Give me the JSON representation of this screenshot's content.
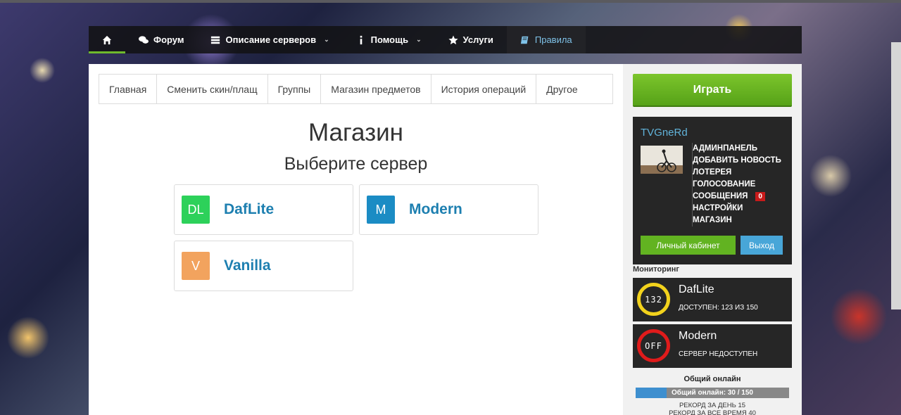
{
  "nav": {
    "home_icon": "home-icon",
    "items": [
      {
        "label": "Форум",
        "icon": "comments-icon"
      },
      {
        "label": "Описание серверов",
        "icon": "server-icon"
      },
      {
        "label": "Помощь",
        "icon": "info-icon"
      },
      {
        "label": "Услуги",
        "icon": "star-icon"
      },
      {
        "label": "Правила",
        "icon": "book-icon"
      }
    ]
  },
  "subnav": [
    "Главная",
    "Сменить скин/плащ",
    "Группы",
    "Магазин предметов",
    "История операций",
    "Другое"
  ],
  "main": {
    "title": "Магазин",
    "subtitle": "Выберите сервер",
    "servers": [
      {
        "badge": "DL",
        "name": "DafLite",
        "color": "#2dd15a"
      },
      {
        "badge": "M",
        "name": "Modern",
        "color": "#1b8cc4"
      },
      {
        "badge": "V",
        "name": "Vanilla",
        "color": "#f2a35e"
      }
    ]
  },
  "sidebar": {
    "play_label": "Играть",
    "username": "TVGneRd",
    "links": [
      "АДМИНПАНЕЛЬ",
      "ДОБАВИТЬ НОВОСТЬ",
      "ЛОТЕРЕЯ",
      "ГОЛОСОВАНИЕ",
      "СООБЩЕНИЯ",
      "НАСТРОЙКИ",
      "МАГАЗИН"
    ],
    "messages_count": "0",
    "cabinet_label": "Личный кабинет",
    "logout_label": "Выход",
    "monitoring_label": "Мониторинг",
    "monitor": [
      {
        "name": "DafLite",
        "gauge": "132",
        "status": "ДОСТУПЕН: 123 ИЗ 150",
        "color": "#f2d21c"
      },
      {
        "name": "Modern",
        "gauge": "OFF",
        "status": "СЕРВЕР НЕДОСТУПЕН",
        "color": "#e01b1b"
      }
    ],
    "online_title": "Общий онлайн",
    "online_text": "Общий онлайн: 30 / 150",
    "online_fraction": 0.2,
    "record_day": "РЕКОРД ЗА ДЕНЬ 15",
    "record_all": "РЕКОРД ЗА ВСЕ ВРЕМЯ 40"
  }
}
